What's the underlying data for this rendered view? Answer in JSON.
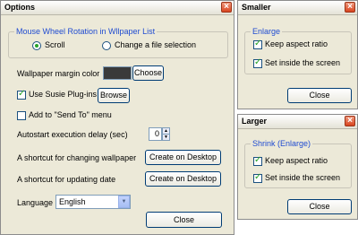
{
  "options_window": {
    "title": "Options",
    "wheel_group": {
      "label": "Mouse Wheel Rotation in Wllpaper List",
      "scroll_label": "Scroll",
      "scroll_selected": true,
      "change_label": "Change a file selection",
      "change_selected": false
    },
    "margin_color_label": "Wallpaper margin color",
    "margin_color": "#3a3a3a",
    "choose_label": "Choose",
    "susie_label": "Use Susie Plug-ins",
    "susie_checked": true,
    "browse_label": "Browse",
    "sendto_label": "Add to \"Send To\" menu",
    "sendto_checked": false,
    "delay_label": "Autostart execution delay (sec)",
    "delay_value": "0",
    "shortcut_change_label": "A shortcut for changing wallpaper",
    "shortcut_change_button": "Create on Desktop",
    "shortcut_update_label": "A shortcut for updating date",
    "shortcut_update_button": "Create on Desktop",
    "language_label": "Language",
    "language_value": "English",
    "close_label": "Close"
  },
  "smaller_window": {
    "title": "Smaller",
    "group_label": "Enlarge",
    "keep_aspect_label": "Keep aspect ratio",
    "keep_aspect_checked": true,
    "set_inside_label": "Set inside the screen",
    "set_inside_checked": true,
    "close_label": "Close"
  },
  "larger_window": {
    "title": "Larger",
    "group_label": "Shrink (Enlarge)",
    "keep_aspect_label": "Keep aspect ratio",
    "keep_aspect_checked": true,
    "set_inside_label": "Set inside the screen",
    "set_inside_checked": true,
    "close_label": "Close"
  },
  "colors": {
    "accent": "#1f4bd1",
    "dialog_bg": "#ece9d8"
  }
}
